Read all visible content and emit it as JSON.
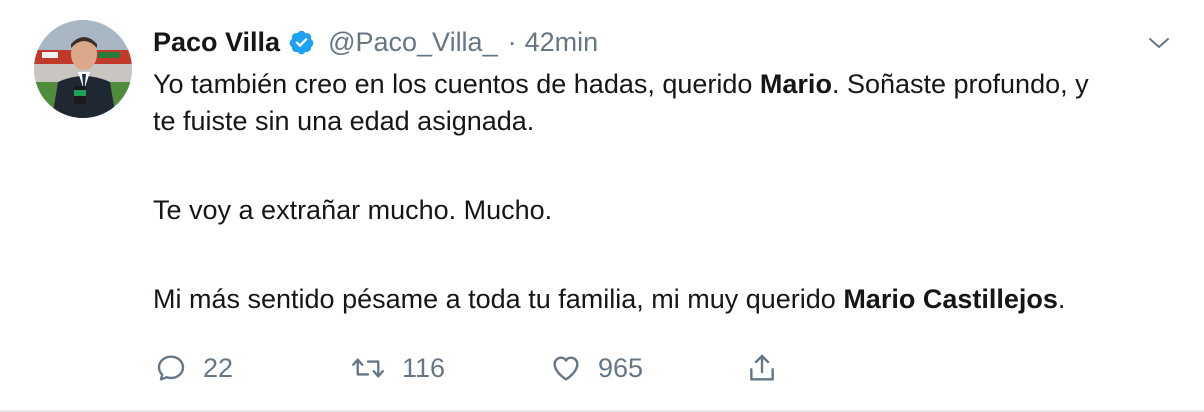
{
  "tweet": {
    "author": {
      "display_name": "Paco Villa",
      "handle": "@Paco_Villa_",
      "verified": true,
      "avatar_icon": "profile-photo"
    },
    "separator": "·",
    "time": "42min",
    "body": {
      "p1_a": "Yo también creo en los cuentos de hadas, querido ",
      "p1_bold": "Mario",
      "p1_b": ". Soñaste profundo, y te fuiste sin una edad asignada.",
      "p2": "Te voy a extrañar mucho. Mucho.",
      "p3_a": "Mi más sentido pésame a toda tu familia, mi muy querido ",
      "p3_bold": "Mario Castillejos",
      "p3_b": "."
    },
    "actions": {
      "replies": "22",
      "retweets": "116",
      "likes": "965"
    },
    "icons": {
      "reply": "speech-bubble-icon",
      "retweet": "retweet-arrows-icon",
      "like": "heart-icon",
      "share": "share-upload-icon",
      "menu": "chevron-down-icon",
      "verified": "verified-badge-icon"
    },
    "colors": {
      "text": "#14171a",
      "secondary": "#657786",
      "verified": "#1da1f2",
      "border": "#e6ecf0"
    }
  }
}
